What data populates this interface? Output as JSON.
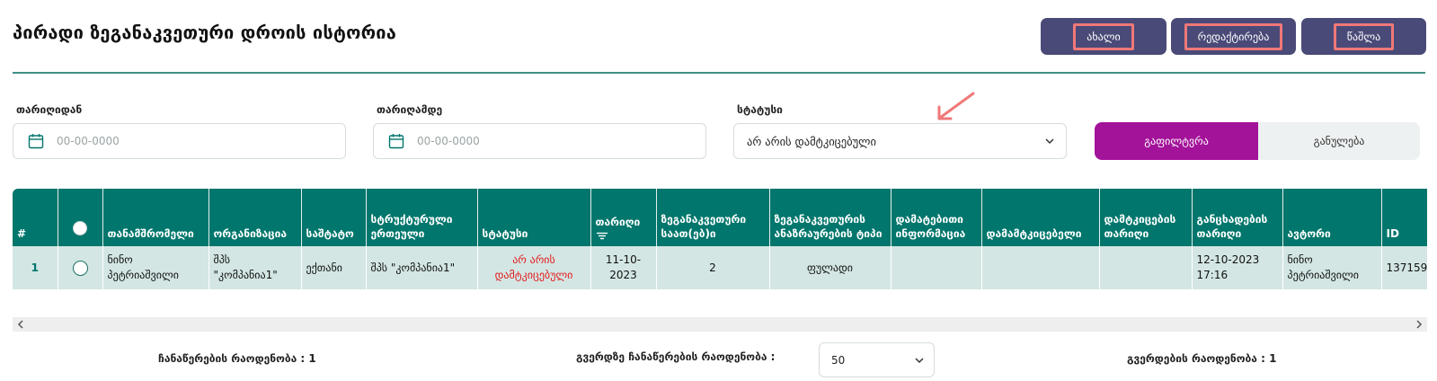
{
  "page": {
    "title": "პირადი ზეგანაკვეთური დროის ისტორია"
  },
  "actions": {
    "new_label": "ახალი",
    "edit_label": "რედაქტირება",
    "delete_label": "წაშლა"
  },
  "filters": {
    "date_from_label": "თარიღიდან",
    "date_from_placeholder": "00-00-0000",
    "date_to_label": "თარიღამდე",
    "date_to_placeholder": "00-00-0000",
    "status_label": "სტატუსი",
    "status_value": "არ არის დამტკიცებული",
    "filter_button": "გაფილტვრა",
    "reset_button": "განულება"
  },
  "table": {
    "headers": [
      "#",
      "",
      "თანამშრომელი",
      "ორგანიზაცია",
      "საშტატო",
      "სტრუქტურული ერთეული",
      "სტატუსი",
      "თარიღი",
      "ზეგანაკვეთური საათ(ებ)ი",
      "ზეგანაკვეთურის ანაზრაურების ტიპი",
      "დამატებითი ინფორმაცია",
      "დამამტკიცებელი",
      "დამტკიცების თარიღი",
      "განცხადების თარიღი",
      "ავტორი",
      "ID"
    ],
    "rows": [
      {
        "num": "1",
        "employee": "ნინო პეტრიაშვილი",
        "organization": "შპს \"კომპანია1\"",
        "position": "ექთანი",
        "unit": "შპს \"კომპანია1\"",
        "status": "არ არის დამტკიცებული",
        "date": "11-10-2023",
        "hours": "2",
        "pay_type": "ფულადი",
        "additional_info": "",
        "approver": "",
        "approval_date": "",
        "request_date": "12-10-2023 17:16",
        "author": "ნინო პეტრიაშვილი",
        "id": "137159"
      }
    ]
  },
  "footer": {
    "records_count": "ჩანაწერების რაოდენობა : 1",
    "per_page_label": "გვერდზე ჩანაწერების რაოდენობა :",
    "per_page_value": "50",
    "pages_count": "გვერდების რაოდენობა : 1"
  },
  "colors": {
    "header_teal": "#01766c",
    "row_bg": "#d3e6e4",
    "action_button": "#4a4a78",
    "annotation_red": "#f07878",
    "filter_purple": "#a3139a",
    "status_red": "#e31b1b"
  }
}
